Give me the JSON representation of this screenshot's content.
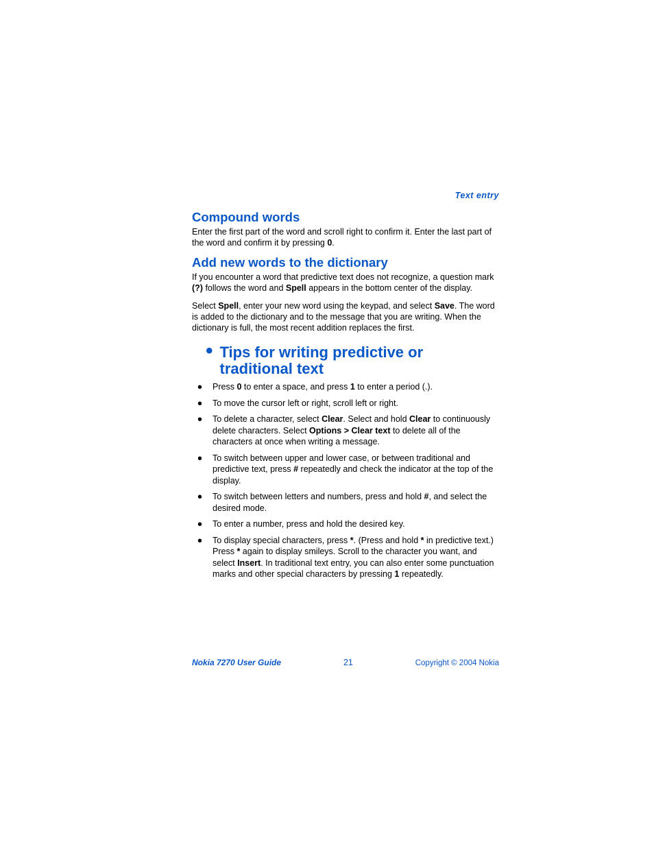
{
  "header": {
    "section_label": "Text entry"
  },
  "sections": {
    "compound": {
      "title": "Compound words",
      "p1_pre": "Enter the first part of the word and scroll right to confirm it. Enter the last part of the word and confirm it by pressing ",
      "p1_key": "0",
      "p1_post": "."
    },
    "addwords": {
      "title": "Add new words to the dictionary",
      "p1_a": "If you encounter a word that predictive text does not recognize, a question mark ",
      "p1_qm": "(?)",
      "p1_b": " follows the word and ",
      "p1_spell": "Spell",
      "p1_c": " appears in the bottom center of the display.",
      "p2_a": "Select ",
      "p2_spell": "Spell",
      "p2_b": ", enter your new word using the keypad, and select ",
      "p2_save": "Save",
      "p2_c": ". The word is added to the dictionary and to the message that you are writing. When the dictionary is full, the most recent addition replaces the first."
    },
    "tips": {
      "title": "Tips for writing predictive or traditional text",
      "items": [
        {
          "a": "Press ",
          "k1": "0",
          "b": " to enter a space, and press ",
          "k2": "1",
          "c": " to enter a period (.)."
        },
        {
          "a": "To move the cursor left or right, scroll left or right."
        },
        {
          "a": "To delete a character, select ",
          "k1": "Clear",
          "b": ". Select and hold ",
          "k2": "Clear",
          "c": " to continuously delete characters. Select ",
          "k3": "Options > Clear text",
          "d": " to delete all of the characters at once when writing a message."
        },
        {
          "a": "To switch between upper and lower case, or between traditional and predictive text, press ",
          "k1": "#",
          "b": " repeatedly and check the indicator at the top of the display."
        },
        {
          "a": "To switch between letters and numbers, press and hold ",
          "k1": "#",
          "b": ", and select the desired mode."
        },
        {
          "a": "To enter a number, press and hold the desired key."
        },
        {
          "a": "To display special characters, press ",
          "k1": "*",
          "b": ". (Press and hold ",
          "k2": "*",
          "c": " in predictive text.) Press ",
          "k3": "*",
          "d": " again to display smileys. Scroll to the character you want, and select ",
          "k4": "Insert",
          "e": ". In traditional text entry, you can also enter some punctuation marks and other special characters by pressing ",
          "k5": "1",
          "f": " repeatedly."
        }
      ]
    }
  },
  "footer": {
    "guide": "Nokia 7270 User Guide",
    "page": "21",
    "copyright": "Copyright © 2004 Nokia"
  }
}
